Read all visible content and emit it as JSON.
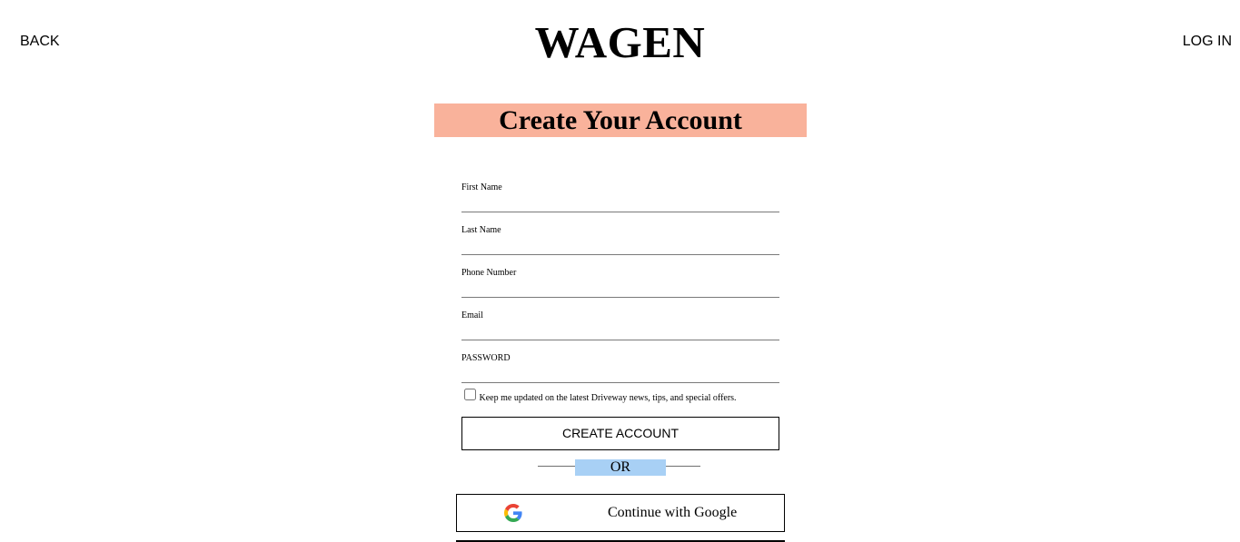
{
  "header": {
    "back_label": "BACK",
    "brand": "WAGEN",
    "login_label": "LOG IN"
  },
  "page": {
    "title": "Create Your Account"
  },
  "form": {
    "fields": [
      {
        "label": "First Name",
        "value": ""
      },
      {
        "label": "Last Name",
        "value": ""
      },
      {
        "label": "Phone Number",
        "value": ""
      },
      {
        "label": "Email",
        "value": ""
      },
      {
        "label": "PASSWORD",
        "value": ""
      }
    ],
    "updates_checkbox": {
      "checked": false,
      "label": "Keep me updated on the latest Driveway news, tips, and special offers."
    },
    "create_button_label": "CREATE ACCOUNT",
    "divider_label": "OR",
    "google_button_label": "Continue with Google"
  },
  "colors": {
    "title_banner": "#f9b29b",
    "or_highlight": "#a8d0f5"
  },
  "icons": {
    "google": "google-g-icon"
  }
}
